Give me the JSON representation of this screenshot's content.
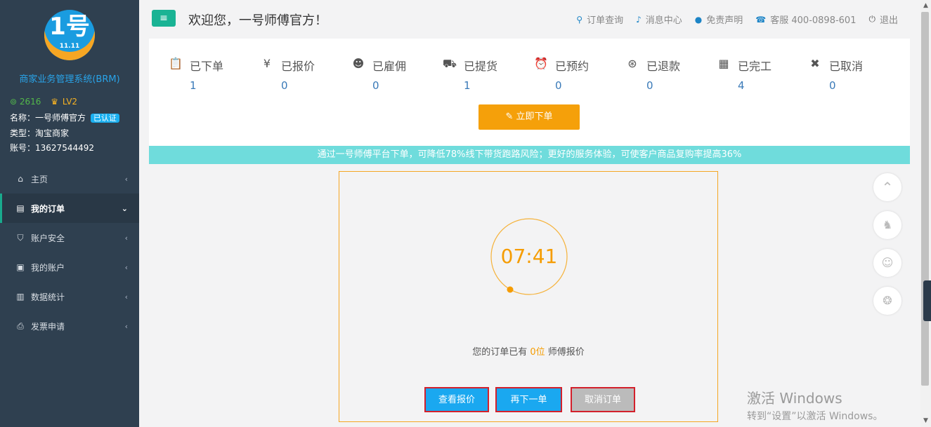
{
  "sidebar": {
    "logo": {
      "main": "1号",
      "sub": "11.11"
    },
    "system_title": "商家业务管理系统(BRM)",
    "points": "2616",
    "level": "LV2",
    "name_label": "名称：",
    "name_value": "一号师傅官方",
    "verified_badge": "已认证",
    "type_label": "类型：",
    "type_value": "淘宝商家",
    "account_label": "账号：",
    "account_value": "13627544492",
    "nav": [
      {
        "label": "主页",
        "icon": "home-icon",
        "active": false
      },
      {
        "label": "我的订单",
        "icon": "order-list-icon",
        "active": true
      },
      {
        "label": "账户安全",
        "icon": "shield-check-icon",
        "active": false
      },
      {
        "label": "我的账户",
        "icon": "wallet-icon",
        "active": false
      },
      {
        "label": "数据统计",
        "icon": "bar-chart-icon",
        "active": false
      },
      {
        "label": "发票申请",
        "icon": "printer-icon",
        "active": false
      }
    ]
  },
  "header": {
    "welcome": "欢迎您，一号师傅官方！",
    "links": [
      {
        "label": "订单查询",
        "icon": "search-icon"
      },
      {
        "label": "消息中心",
        "icon": "bell-icon"
      },
      {
        "label": "免责声明",
        "icon": "chat-icon"
      },
      {
        "label": "客服 400-0898-601",
        "icon": "phone-icon"
      },
      {
        "label": "退出",
        "icon": "power-icon"
      }
    ]
  },
  "status": [
    {
      "label": "已下单",
      "count": "1",
      "icon": "clipboard-check-icon"
    },
    {
      "label": "已报价",
      "count": "0",
      "icon": "yen-receipt-icon"
    },
    {
      "label": "已雇佣",
      "count": "0",
      "icon": "worker-icon"
    },
    {
      "label": "已提货",
      "count": "1",
      "icon": "truck-icon"
    },
    {
      "label": "已预约",
      "count": "0",
      "icon": "alarm-clock-icon"
    },
    {
      "label": "已退款",
      "count": "0",
      "icon": "yen-coin-icon"
    },
    {
      "label": "已完工",
      "count": "4",
      "icon": "calendar-check-icon"
    },
    {
      "label": "已取消",
      "count": "0",
      "icon": "cancel-circle-icon"
    }
  ],
  "order_button": "✎ 立即下单",
  "banner": "通过一号师傅平台下单，可降低78%线下带货跑路风险；更好的服务体验，可使客户商品复购率提高36%",
  "order_card": {
    "timer": "07:41",
    "quote_prefix": "您的订单已有 ",
    "quote_count": "0位",
    "quote_suffix": " 师傅报价",
    "buttons": {
      "view_quotes": "查看报价",
      "reorder": "再下一单",
      "cancel": "取消订单"
    }
  },
  "floating": [
    "back-to-top-icon",
    "qq-icon",
    "customer-service-icon",
    "wechat-icon"
  ],
  "watermark": {
    "line1": "激活 Windows",
    "line2": "转到“设置”以激活 Windows。"
  },
  "colors": {
    "accent_green": "#1ab394",
    "accent_orange": "#f5a00a",
    "link_blue": "#1c84c6",
    "banner_cyan": "#6fdcdc",
    "sidebar_bg": "#2f4050"
  }
}
